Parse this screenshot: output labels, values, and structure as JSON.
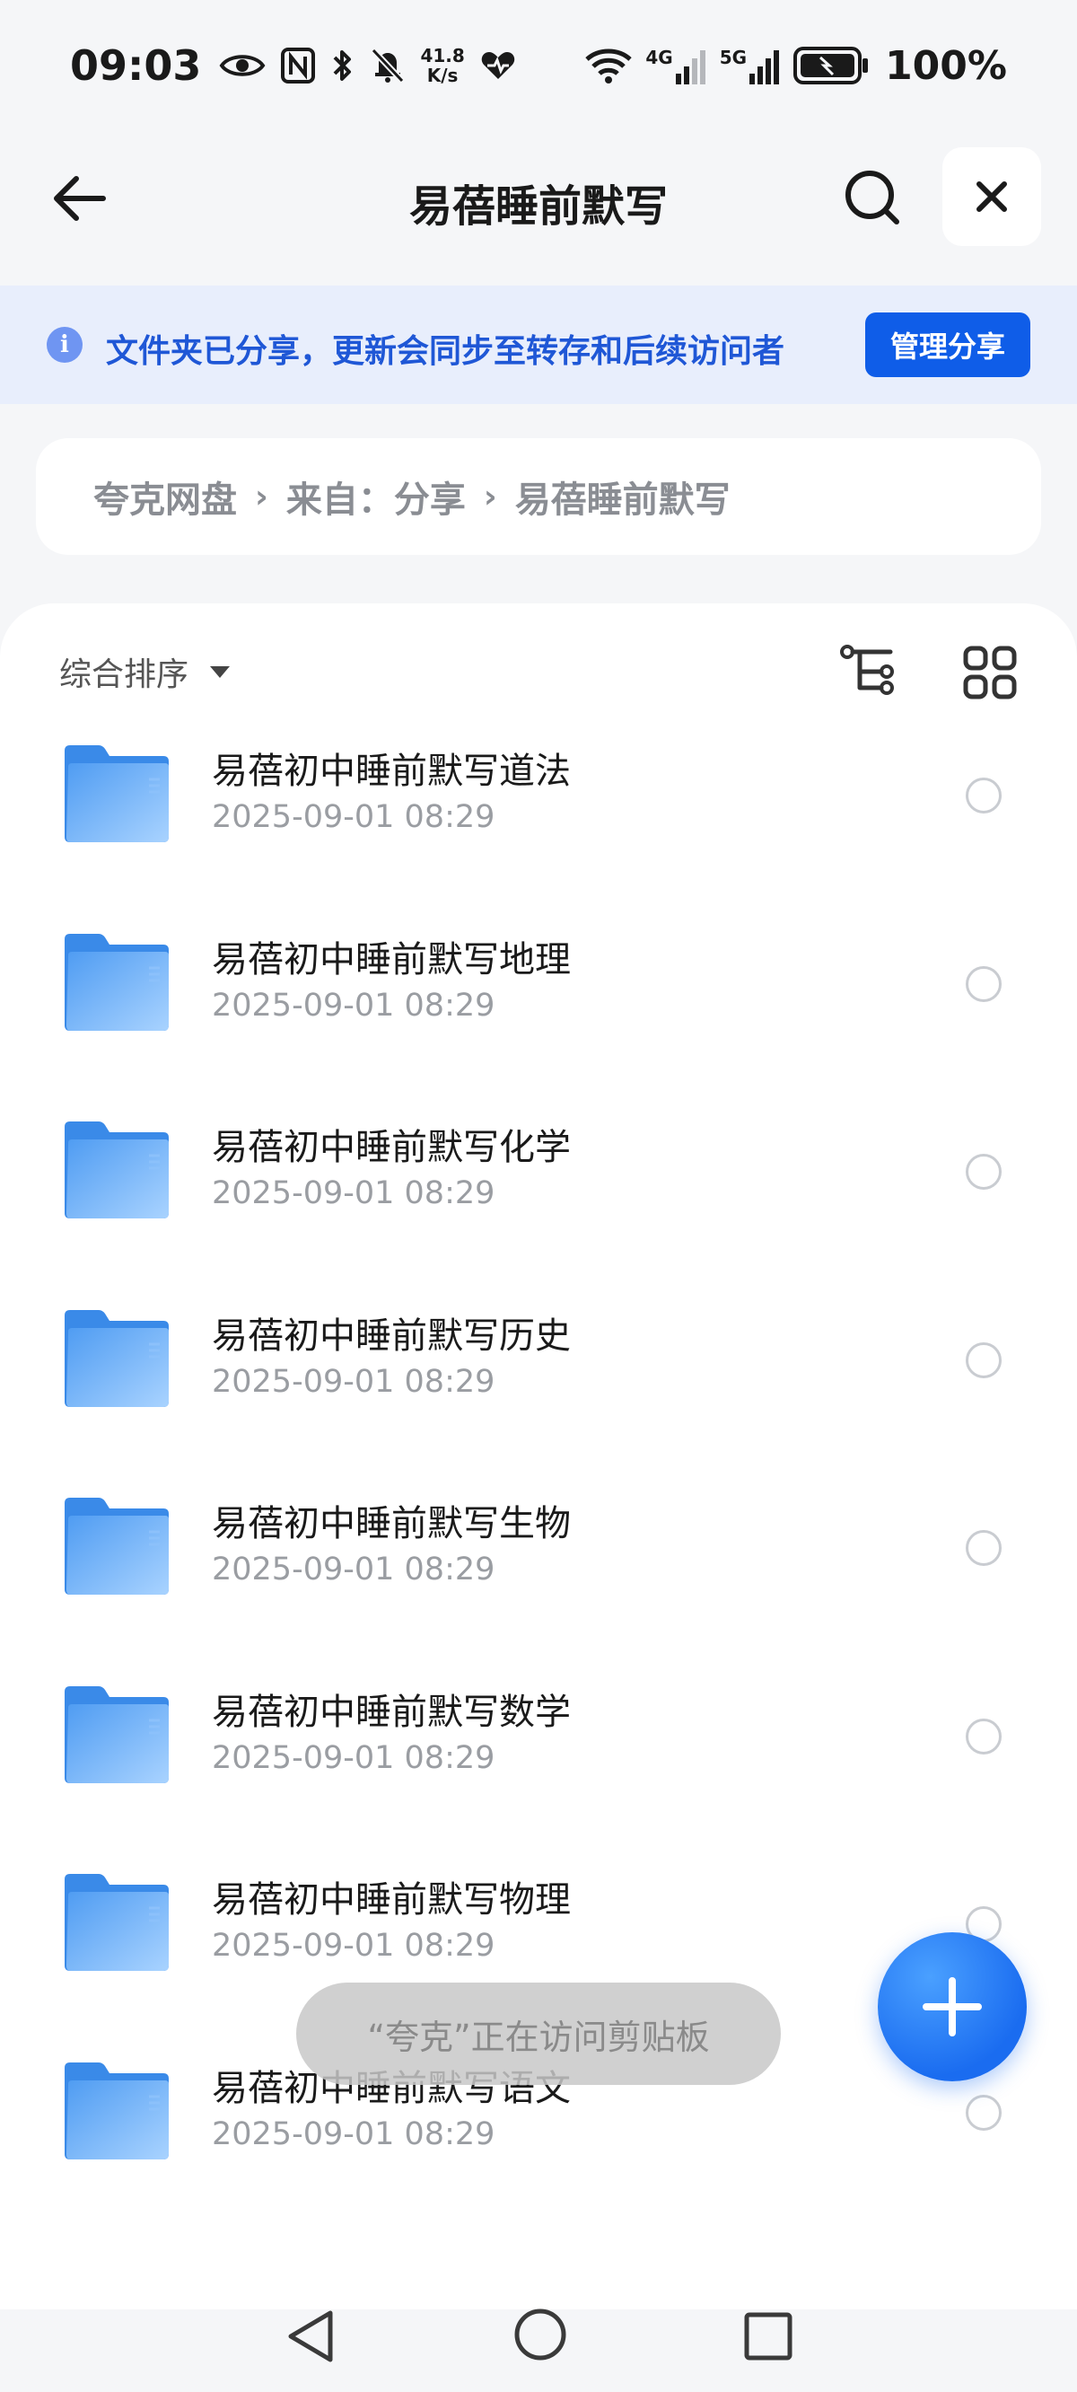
{
  "status_bar": {
    "time": "09:03",
    "speed_value": "41.8",
    "speed_unit": "K/s",
    "net1": "4G",
    "net2": "5G",
    "battery": "100%"
  },
  "header": {
    "title": "易蓓睡前默写"
  },
  "banner": {
    "text": "文件夹已分享，更新会同步至转存和后续访问者",
    "button": "管理分享"
  },
  "breadcrumb": [
    "夸克网盘",
    "来自：分享",
    "易蓓睡前默写"
  ],
  "list": {
    "sort_label": "综合排序",
    "items": [
      {
        "name": "易蓓初中睡前默写道法",
        "date": "2025-09-01 08:29"
      },
      {
        "name": "易蓓初中睡前默写地理",
        "date": "2025-09-01 08:29"
      },
      {
        "name": "易蓓初中睡前默写化学",
        "date": "2025-09-01 08:29"
      },
      {
        "name": "易蓓初中睡前默写历史",
        "date": "2025-09-01 08:29"
      },
      {
        "name": "易蓓初中睡前默写生物",
        "date": "2025-09-01 08:29"
      },
      {
        "name": "易蓓初中睡前默写数学",
        "date": "2025-09-01 08:29"
      },
      {
        "name": "易蓓初中睡前默写物理",
        "date": "2025-09-01 08:29"
      },
      {
        "name": "易蓓初中睡前默写语文",
        "date": "2025-09-01 08:29"
      }
    ]
  },
  "toast": "“夸克”正在访问剪贴板",
  "colors": {
    "accent": "#0f5de8",
    "banner_bg": "#e8eefc",
    "folder": "#5aa8f5"
  }
}
